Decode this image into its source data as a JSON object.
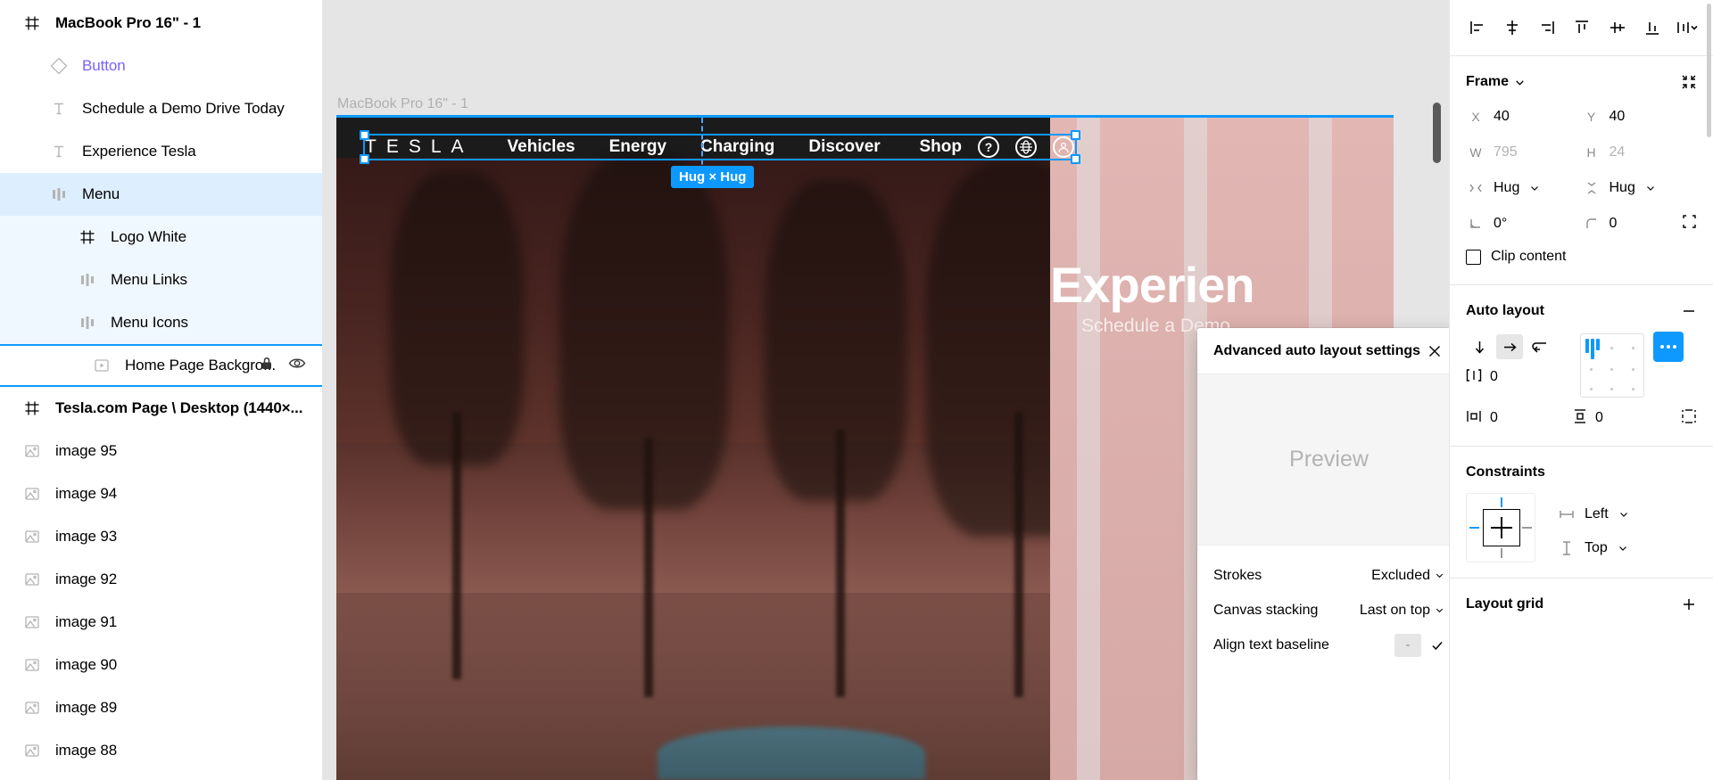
{
  "layers": {
    "items": [
      {
        "label": "MacBook Pro 16\" - 1",
        "icon": "frame-icon",
        "indent": 0,
        "bold": true,
        "state": "none"
      },
      {
        "label": "Button",
        "icon": "component-icon",
        "indent": 1,
        "bold": false,
        "state": "none",
        "color": "purple"
      },
      {
        "label": "Schedule a Demo Drive Today",
        "icon": "text-icon",
        "indent": 1,
        "bold": false,
        "state": "none"
      },
      {
        "label": "Experience Tesla",
        "icon": "text-icon",
        "indent": 1,
        "bold": false,
        "state": "none"
      },
      {
        "label": "Menu",
        "icon": "autolayout-horizontal-icon",
        "indent": 1,
        "bold": false,
        "state": "sel-parent"
      },
      {
        "label": "Logo White",
        "icon": "frame-icon",
        "indent": 2,
        "bold": false,
        "state": "sel-child"
      },
      {
        "label": "Menu Links",
        "icon": "autolayout-horizontal-icon",
        "indent": 2,
        "bold": false,
        "state": "sel-child"
      },
      {
        "label": "Menu Icons",
        "icon": "autolayout-horizontal-icon",
        "indent": 2,
        "bold": false,
        "state": "sel-child"
      },
      {
        "label": "Home Page Backgro...",
        "icon": "video-icon",
        "indent": 3,
        "bold": false,
        "state": "sel-active",
        "lock": "lock-icon",
        "visibility": "eye-icon"
      },
      {
        "label": "Tesla.com Page \\ Desktop (1440×...",
        "icon": "frame-icon",
        "indent": 0,
        "bold": true,
        "state": "none"
      },
      {
        "label": "image 95",
        "icon": "image-icon",
        "indent": 0,
        "bold": false,
        "state": "none"
      },
      {
        "label": "image 94",
        "icon": "image-icon",
        "indent": 0,
        "bold": false,
        "state": "none"
      },
      {
        "label": "image 93",
        "icon": "image-icon",
        "indent": 0,
        "bold": false,
        "state": "none"
      },
      {
        "label": "image 92",
        "icon": "image-icon",
        "indent": 0,
        "bold": false,
        "state": "none"
      },
      {
        "label": "image 91",
        "icon": "image-icon",
        "indent": 0,
        "bold": false,
        "state": "none"
      },
      {
        "label": "image 90",
        "icon": "image-icon",
        "indent": 0,
        "bold": false,
        "state": "none"
      },
      {
        "label": "image 89",
        "icon": "image-icon",
        "indent": 0,
        "bold": false,
        "state": "none"
      },
      {
        "label": "image 88",
        "icon": "image-icon",
        "indent": 0,
        "bold": false,
        "state": "none"
      }
    ]
  },
  "canvas": {
    "frame_label": "MacBook Pro 16\" - 1",
    "size_badge": "Hug × Hug",
    "artboard": {
      "logo": "TESLA",
      "nav_links": [
        "Vehicles",
        "Energy",
        "Charging",
        "Discover",
        "Shop"
      ],
      "nav_icons": [
        "help-icon",
        "globe-icon",
        "account-icon"
      ],
      "hero_title": "Experien",
      "hero_subtitle": "Schedule a Demo"
    }
  },
  "dialog": {
    "title": "Advanced auto layout settings",
    "close_icon": "close-icon",
    "preview_label": "Preview",
    "rows": [
      {
        "label": "Strokes",
        "value": "Excluded",
        "control": "dropdown"
      },
      {
        "label": "Canvas stacking",
        "value": "Last on top",
        "control": "dropdown"
      },
      {
        "label": "Align text baseline",
        "value": "-",
        "control": "toggle-check"
      }
    ]
  },
  "properties": {
    "align_buttons": [
      "align-left-icon",
      "align-horizontal-centers-icon",
      "align-right-icon",
      "align-top-icon",
      "align-vertical-centers-icon",
      "align-bottom-icon",
      "distribute-more-icon"
    ],
    "frame": {
      "title": "Frame",
      "collapse_icon": "chevron-down-icon",
      "action_icon": "collapse-all-icon",
      "x_label": "X",
      "x_value": "40",
      "y_label": "Y",
      "y_value": "40",
      "w_label": "W",
      "w_value": "795",
      "h_label": "H",
      "h_value": "24",
      "resize_horizontal": "Hug",
      "resize_vertical": "Hug",
      "rotation": "0°",
      "corner_radius": "0",
      "independent_corners_icon": "independent-corners-icon",
      "clip_content_label": "Clip content",
      "clip_content_checked": false
    },
    "auto_layout": {
      "title": "Auto layout",
      "remove_icon": "minus-icon",
      "direction_vertical_icon": "arrow-down-icon",
      "direction_horizontal_icon": "arrow-right-icon",
      "direction_wrap_icon": "wrap-icon",
      "direction_selected": "horizontal",
      "gap_value": "0",
      "horizontal_padding": "0",
      "vertical_padding": "0",
      "more_settings_icon": "ellipsis-icon",
      "individual_padding_icon": "individual-padding-icon",
      "alignment": "top-left"
    },
    "constraints": {
      "title": "Constraints",
      "horizontal": "Left",
      "vertical": "Top"
    },
    "layout_grid": {
      "title": "Layout grid",
      "add_icon": "plus-icon"
    }
  },
  "colors": {
    "accent": "#0d99ff",
    "component_purple": "#7b61ff",
    "selection_row_parent": "#ddeeff",
    "selection_row_child": "#f0f8ff"
  }
}
